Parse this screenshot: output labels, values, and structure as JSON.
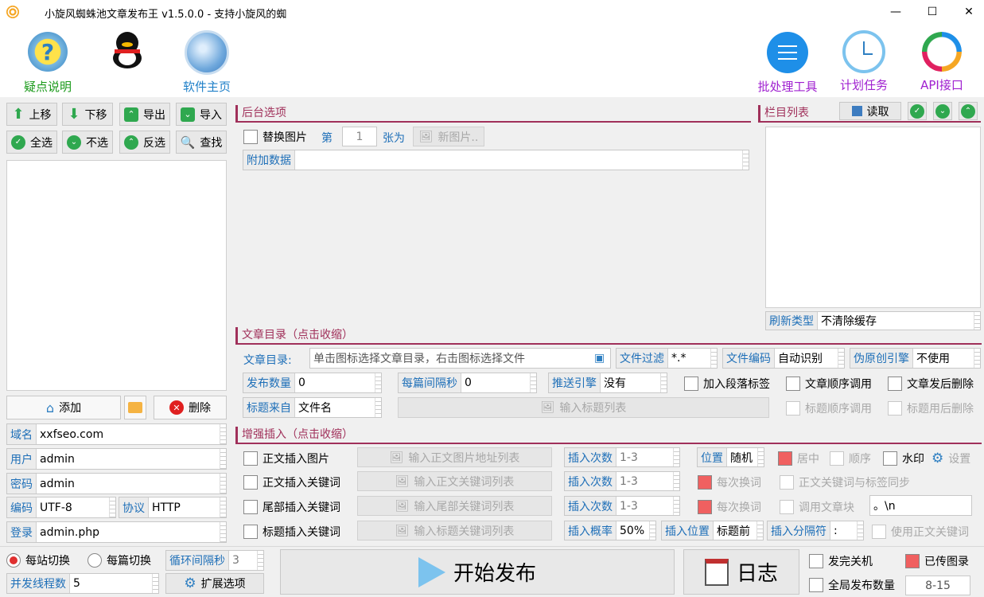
{
  "window": {
    "title": "小旋风蜘蛛池文章发布王 v1.5.0.0 - 支持小旋风的蜘",
    "minimize": "—",
    "maximize": "☐",
    "close": "✕"
  },
  "toolbar": {
    "help": "疑点说明",
    "home": "软件主页",
    "batch": "批处理工具",
    "schedule": "计划任务",
    "api": "API接口"
  },
  "left": {
    "up": "上移",
    "down": "下移",
    "export": "导出",
    "import": "导入",
    "select_all": "全选",
    "select_none": "不选",
    "invert": "反选",
    "find": "查找",
    "add": "添加",
    "delete": "删除",
    "fields": [
      {
        "k": "域名",
        "v": "xxfseo.com"
      },
      {
        "k": "用户",
        "v": "admin"
      },
      {
        "k": "密码",
        "v": "admin"
      },
      {
        "k": "登录",
        "v": "admin.php"
      }
    ],
    "encoding_k": "编码",
    "encoding_v": "UTF-8",
    "protocol_k": "协议",
    "protocol_v": "HTTP"
  },
  "backend": {
    "title": "后台选项",
    "replace_img": "替换图片",
    "nth": "第",
    "nth_value": "1",
    "to": "张为",
    "new_img": "新图片..",
    "extra": "附加数据",
    "extra_value": ""
  },
  "columns": {
    "title": "栏目列表",
    "read": "读取",
    "refresh_k": "刷新类型",
    "refresh_v": "不清除缓存"
  },
  "articles": {
    "title": "文章目录（点击收缩）",
    "dir_k": "文章目录:",
    "dir_v": "单击图标选择文章目录，右击图标选择文件",
    "filter_k": "文件过滤",
    "filter_v": "*.*",
    "enc_k": "文件编码",
    "enc_v": "自动识别",
    "orig_k": "伪原创引擎",
    "orig_v": "不使用",
    "count_k": "发布数量",
    "count_v": "0",
    "interval_k": "每篇间隔秒",
    "interval_v": "0",
    "push_k": "推送引擎",
    "push_v": "没有",
    "para_tag": "加入段落标签",
    "seq": "文章顺序调用",
    "del_after": "文章发后删除",
    "title_src_k": "标题来自",
    "title_src_v": "文件名",
    "title_list": "输入标题列表",
    "title_seq": "标题顺序调用",
    "title_del": "标题用后删除"
  },
  "enhance": {
    "title": "增强插入（点击收缩）",
    "rows": [
      {
        "label": "正文插入图片",
        "input": "输入正文图片地址列表",
        "k": "插入次数",
        "v": "1-3"
      },
      {
        "label": "正文插入关键词",
        "input": "输入正文关键词列表",
        "k": "插入次数",
        "v": "1-3"
      },
      {
        "label": "尾部插入关键词",
        "input": "输入尾部关键词列表",
        "k": "插入次数",
        "v": "1-3"
      },
      {
        "label": "标题插入关键词",
        "input": "输入标题关键词列表",
        "k": "插入概率",
        "v": "50%"
      }
    ],
    "pos_k": "位置",
    "pos_v": "随机",
    "center": "居中",
    "order": "顺序",
    "watermark": "水印",
    "settings": "设置",
    "each1": "每次换词",
    "sync": "正文关键词与标签同步",
    "each2": "每次换词",
    "call_block": "调用文章块",
    "block_v": "。\\n",
    "ins_pos_k": "插入位置",
    "ins_pos_v": "标题前",
    "sep_k": "插入分隔符",
    "sep_v": ":",
    "use_body": "使用正文关键词"
  },
  "bottom": {
    "per_site": "每站切换",
    "per_post": "每篇切换",
    "loop_k": "循环间隔秒",
    "loop_v": "3",
    "threads_k": "并发线程数",
    "threads_v": "5",
    "ext": "扩展选项",
    "start": "开始发布",
    "log": "日志",
    "shutdown": "发完关机",
    "uploaded": "已传图录",
    "global": "全局发布数量",
    "global_v": "8-15"
  }
}
